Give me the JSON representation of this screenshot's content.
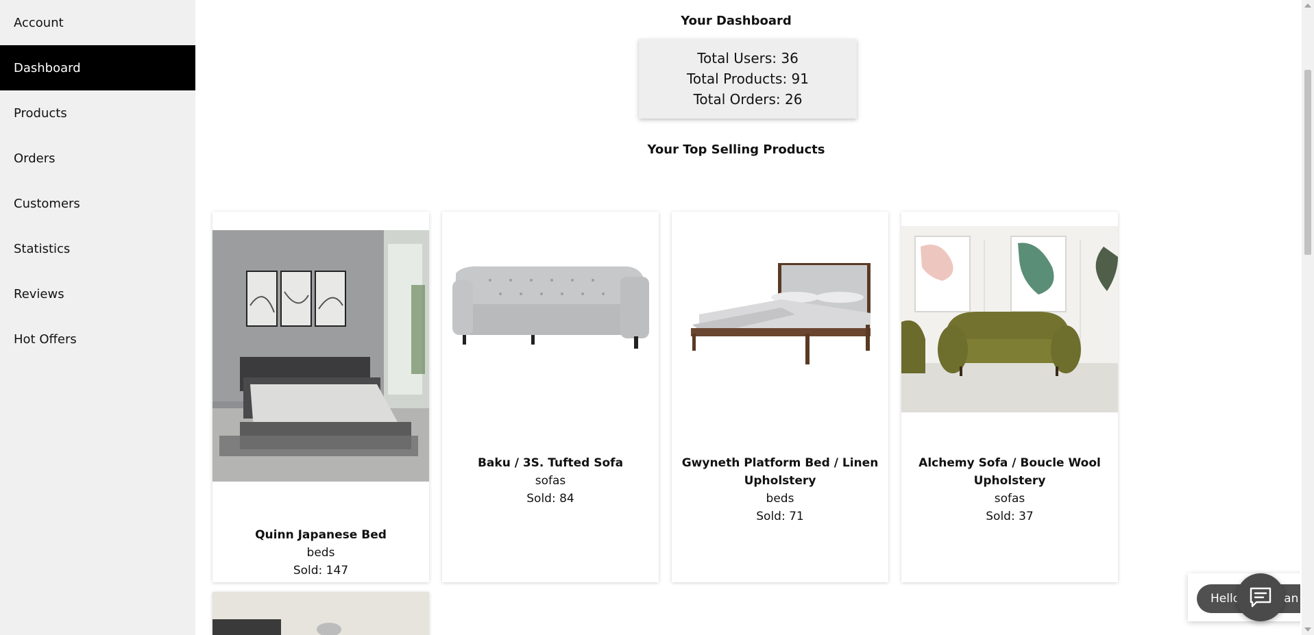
{
  "sidebar": {
    "items": [
      {
        "label": "Account",
        "active": false
      },
      {
        "label": "Dashboard",
        "active": true
      },
      {
        "label": "Products",
        "active": false
      },
      {
        "label": "Orders",
        "active": false
      },
      {
        "label": "Customers",
        "active": false
      },
      {
        "label": "Statistics",
        "active": false
      },
      {
        "label": "Reviews",
        "active": false
      },
      {
        "label": "Hot Offers",
        "active": false
      }
    ]
  },
  "dashboard": {
    "title": "Your Dashboard",
    "stats": {
      "users": "Total Users: 36",
      "products": "Total Products: 91",
      "orders": "Total Orders: 26"
    },
    "top_selling_title": "Your Top Selling Products"
  },
  "products": [
    {
      "name": "Quinn Japanese Bed",
      "category": "beds",
      "sold": "Sold: 147",
      "image": "bedroom-platform-bed-photo"
    },
    {
      "name": "Baku / 3S. Tufted Sofa",
      "category": "sofas",
      "sold": "Sold: 84",
      "image": "grey-tufted-sofa-photo"
    },
    {
      "name": "Gwyneth Platform Bed / Linen Upholstery",
      "category": "beds",
      "sold": "Sold: 71",
      "image": "wood-platform-bed-photo"
    },
    {
      "name": "Alchemy Sofa / Boucle Wool Upholstery",
      "category": "sofas",
      "sold": "Sold: 37",
      "image": "olive-boucle-sofa-photo"
    }
  ],
  "chat": {
    "greeting": "Hello! How can I help you?",
    "close_icon": "close-icon",
    "launcher_icon": "chat-icon"
  },
  "colors": {
    "sidebar_bg": "#f0f0f0",
    "active_bg": "#000000",
    "stats_bg": "#eeeeee",
    "chat_bg": "#505050"
  }
}
